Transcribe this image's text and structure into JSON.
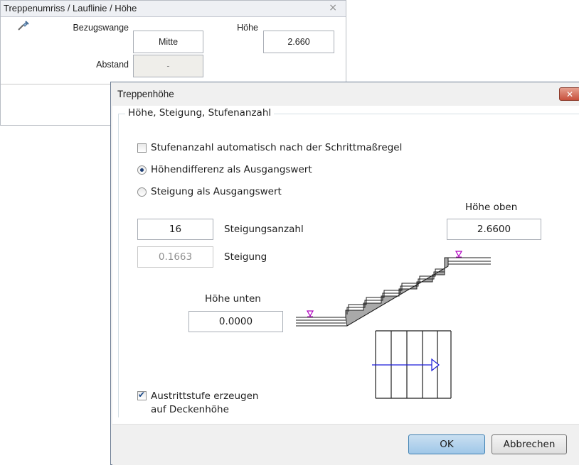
{
  "palette": {
    "title": "Treppenumriss / Lauflinie / Höhe",
    "close_glyph": "×",
    "bezugswange_label": "Bezugswange",
    "bezugswange_value": "Mitte",
    "hoehe_label": "Höhe",
    "hoehe_value": "2.660",
    "abstand_label": "Abstand",
    "abstand_value": "-"
  },
  "dialog": {
    "title": "Treppenhöhe",
    "close_glyph": "✕",
    "group_title": "Höhe, Steigung, Stufenanzahl",
    "option_auto_count": {
      "label": "Stufenanzahl automatisch nach der Schrittmaßregel",
      "checked": false
    },
    "radio_height_diff": {
      "label": "Höhendifferenz als Ausgangswert",
      "selected": true
    },
    "radio_rise": {
      "label": "Steigung als Ausgangswert",
      "selected": false
    },
    "riser_count_value": "16",
    "riser_count_label": "Steigungsanzahl",
    "rise_value": "0.1663",
    "rise_label": "Steigung",
    "top_height_label": "Höhe oben",
    "top_height_value": "2.6600",
    "bottom_height_label": "Höhe unten",
    "bottom_height_value": "0.0000",
    "exit_step": {
      "label_line1": "Austrittstufe erzeugen",
      "label_line2": "auf Deckenhöhe",
      "checked": true
    },
    "ok_label": "OK",
    "cancel_label": "Abbrechen"
  },
  "colors": {
    "marker": "#b000c0",
    "arrow": "#1a1adb",
    "hatch": "#6d6d6d"
  }
}
